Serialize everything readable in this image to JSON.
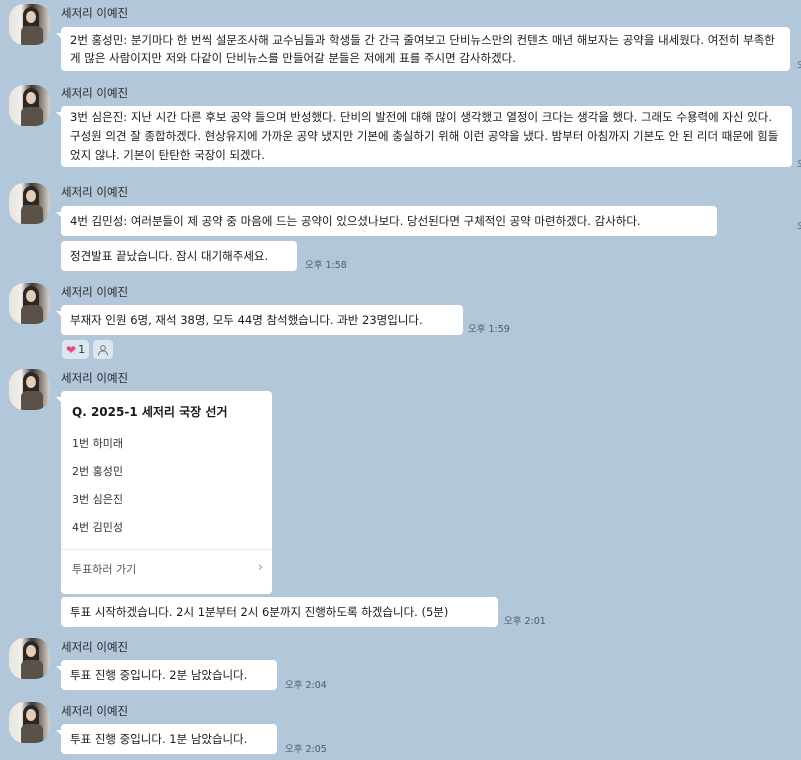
{
  "sender_name": "세저리 이예진",
  "messages": [
    {
      "text": "2번 홍성민: 분기마다 한 번씩 설문조사해 교수님들과 학생들 간 간극 줄여보고 단비뉴스만의 컨텐츠 매년 해보자는 공약을 내세웠다. 여전히 부족한 게 많은 사람이지만 저와 다같이 단비뉴스를 만들어갈 분들은 저에게 표를 주시면 감사하겠다.",
      "time": ""
    },
    {
      "text": "3번 심은진: 지난 시간 다른 후보 공약 들으며 반성했다. 단비의 발전에 대해 많이 생각했고 열정이 크다는 생각을 했다. 그래도 수용력에 자신 있다. 구성원 의견 잘 종합하겠다. 현상유지에 가까운 공약 냈지만 기본에 충실하기 위해 이런 공약을 냈다. 밤부터 아침까지 기본도 안 된 리더 때문에 힘들었지 않냐. 기본이 탄탄한 국장이 되겠다.",
      "time": ""
    },
    {
      "text": "4번 김민성: 여러분들이 제 공약 중 마음에 드는 공약이 있으셨나보다. 당선된다면 구체적인 공약 마련하겠다. 감사하다.",
      "time": ""
    },
    {
      "text": "정견발표 끝났습니다. 잠시 대기해주세요.",
      "time": "오후 1:58"
    },
    {
      "text": "부재자 인원 6명, 재석 38명, 모두 44명 참석했습니다. 과반 23명입니다.",
      "time": "오후 1:59"
    },
    {
      "text": "투표 시작하겠습니다. 2시 1분부터 2시 6분까지 진행하도록  하겠습니다. (5분)",
      "time": "오후 2:01"
    },
    {
      "text": "투표 진행 중입니다. 2분 남았습니다.",
      "time": "오후 2:04"
    },
    {
      "text": "투표 진행 중입니다. 1분 남았습니다.",
      "time": "오후 2:05"
    }
  ],
  "reactions": {
    "heart_count": "1"
  },
  "poll": {
    "title": "Q. 2025-1 세저리 국장 선거",
    "options": [
      "1번 하미래",
      "2번 홍성민",
      "3번 심은진",
      "4번 김민성"
    ],
    "action_label": "투표하러 가기"
  },
  "edge_marks": [
    "오",
    "오",
    "오"
  ],
  "colors": {
    "background": "#b2c7d9",
    "bubble": "#ffffff",
    "heart": "#e8487d"
  },
  "icons": [
    "heart-icon",
    "person-icon",
    "chevron-right-icon"
  ]
}
